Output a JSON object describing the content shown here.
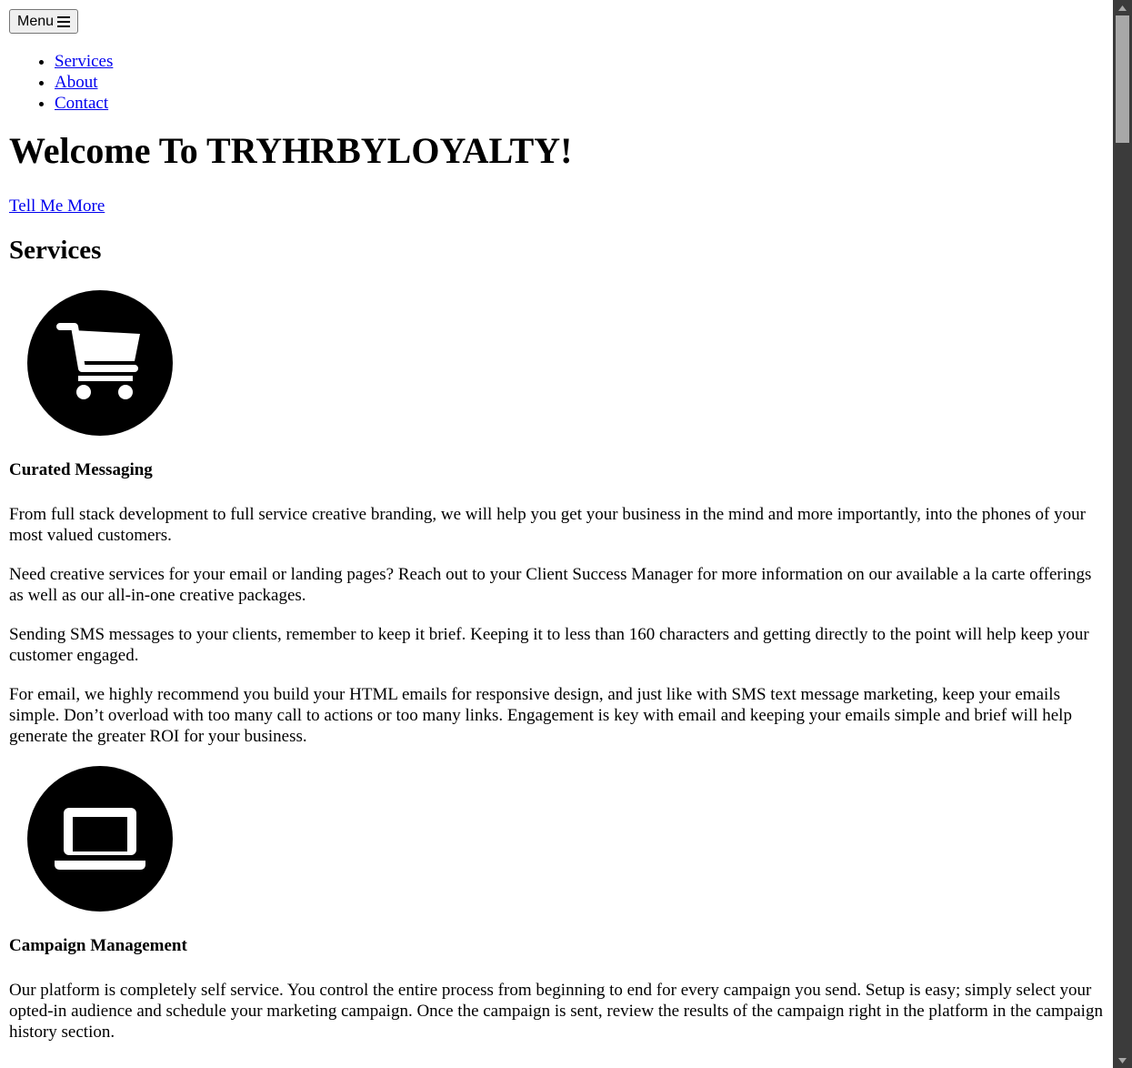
{
  "header": {
    "menu_label": "Menu"
  },
  "nav": {
    "items": [
      {
        "label": "Services"
      },
      {
        "label": "About"
      },
      {
        "label": "Contact"
      }
    ]
  },
  "hero": {
    "title": "Welcome To TRYHRBYLOYALTY!",
    "cta": "Tell Me More"
  },
  "services": {
    "heading": "Services",
    "items": [
      {
        "icon": "shopping-cart-icon",
        "title": "Curated Messaging",
        "paragraphs": [
          "From full stack development to full service creative branding, we will help you get your business in the mind and more importantly, into the phones of your most valued customers.",
          "Need creative services for your email or landing pages? Reach out to your Client Success Manager for more information on our available a la carte offerings as well as our all-in-one creative packages.",
          "Sending SMS messages to your clients, remember to keep it brief. Keeping it to less than 160 characters and getting directly to the point will help keep your customer engaged.",
          "For email, we highly recommend you build your HTML emails for responsive design, and just like with SMS text message marketing, keep your emails simple. Don’t overload with too many call to actions or too many links. Engagement is key with email and keeping your emails simple and brief will help generate the greater ROI for your business."
        ]
      },
      {
        "icon": "laptop-icon",
        "title": "Campaign Management",
        "paragraphs": [
          "Our platform is completely self service. You control the entire process from beginning to end for every campaign you send. Setup is easy; simply select your opted-in audience and schedule your marketing campaign. Once the campaign is sent, review the results of the campaign right in the platform in the campaign history section."
        ]
      }
    ]
  }
}
